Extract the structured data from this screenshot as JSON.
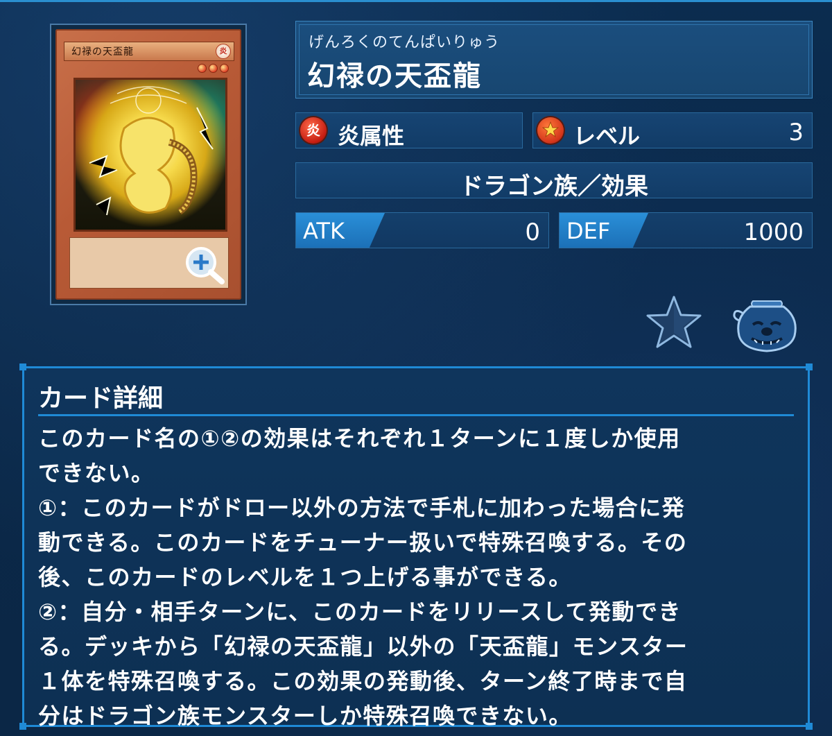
{
  "card": {
    "ruby": "げんろくのてんぱいりゅう",
    "name": "幻禄の天盃龍",
    "card_face_name": "幻禄の天盃龍",
    "card_face_attribute_glyph": "炎",
    "card_face_level_stars": 3
  },
  "attribute": {
    "icon": "fire-attribute-icon",
    "label": "炎属性",
    "icon_glyph": "炎",
    "color": "#c41c10"
  },
  "level": {
    "icon": "level-star-icon",
    "label": "レベル",
    "value": "3"
  },
  "type_line": "ドラゴン族／効果",
  "stats": {
    "atk_label": "ATK",
    "atk_value": "0",
    "def_label": "DEF",
    "def_value": "1000"
  },
  "actions": {
    "zoom_icon": "zoom-in-icon",
    "favorite_icon": "star-icon",
    "jar_icon": "pot-of-greed-icon"
  },
  "details": {
    "heading": "カード詳細",
    "text": "このカード名の①②の効果はそれぞれ１ターンに１度しか使用\nできない。\n①：このカードがドロー以外の方法で手札に加わった場合に発\n動できる。このカードをチューナー扱いで特殊召喚する。その\n後、このカードのレベルを１つ上げる事ができる。\n②：自分・相手ターンに、このカードをリリースして発動でき\nる。デッキから「幻禄の天盃龍」以外の「天盃龍」モンスター\n１体を特殊召喚する。この効果の発動後、ターン終了時まで自\n分はドラゴン族モンスターしか特殊召喚できない。"
  },
  "colors": {
    "accent": "#1f8ad6",
    "background": "#0b2c4f",
    "stat_tag": "#2a8fd8"
  }
}
